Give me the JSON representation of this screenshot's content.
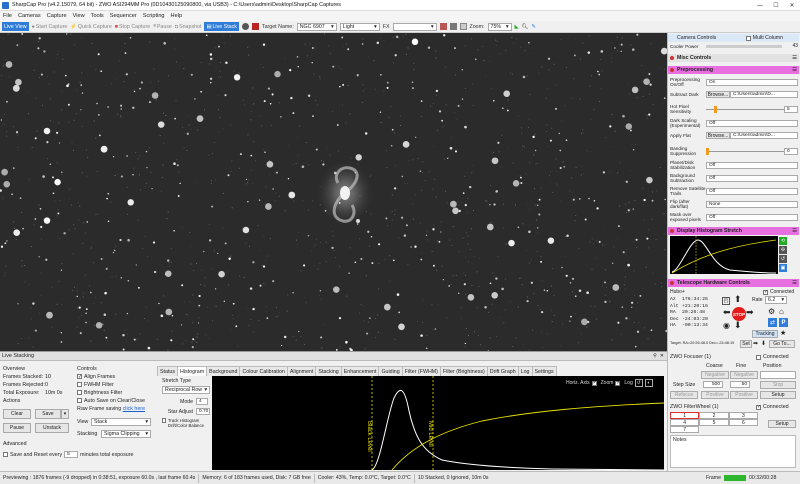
{
  "window": {
    "title": "SharpCap Pro (v4.2.15079, 64 bit) - ZWO ASI294MM Pro (0D10430125090800, via USB3) - C:\\Users\\admin\\Desktop\\SharpCap Captures"
  },
  "menu": [
    "File",
    "Cameras",
    "Capture",
    "View",
    "Tools",
    "Sequencer",
    "Scripting",
    "Help"
  ],
  "toolbar": {
    "live_view": "Live View",
    "start_capture": "Start Capture",
    "quick_capture": "Quick Capture",
    "stop_capture": "Stop Capture",
    "pause": "Pause",
    "snapshot": "Snapshot",
    "live_stack": "Live Stack",
    "target_label": "Target Name:",
    "target_value": "NGC 6907",
    "frame_type": "Light",
    "fx_label": "FX",
    "zoom_label": "Zoom:",
    "zoom_value": "75%"
  },
  "right_panel": {
    "camera_controls": "Camera Controls",
    "multi_column": "Multi Column",
    "cooler_power_label": "Cooler Power",
    "cooler_power_value": "43",
    "misc_controls": "Misc Controls",
    "preprocessing": "Preprocessing",
    "rows": [
      {
        "label": "Preprocessing On/Off",
        "value": "On"
      },
      {
        "label": "Subtract Dark",
        "button": "Browse...",
        "value": "C:\\Users\\admin\\D..."
      },
      {
        "label": "Hot Pixel Sensitivity",
        "value": "5"
      },
      {
        "label": "Dark Scaling (Experimental)",
        "value": "Off"
      },
      {
        "label": "Apply Flat",
        "button": "Browse...",
        "value": "C:\\Users\\admin\\D..."
      },
      {
        "label": "Banding Suppression",
        "value": "0"
      },
      {
        "label": "Planet/Disk Stabilization",
        "value": "Off"
      },
      {
        "label": "Background Subtraction",
        "value": "Off"
      },
      {
        "label": "Remove Satellite Trails",
        "value": "Off"
      },
      {
        "label": "Flip (after dark/flat)",
        "value": "None"
      },
      {
        "label": "Mask over exposed pixels",
        "value": "Off"
      }
    ],
    "display_histogram": "Display Histogram Stretch",
    "telescope": "Telescope Hardware Controls",
    "mount_name": "Hubo+",
    "connected_label": "Connected",
    "az_label": "Az",
    "az": "176:34:26",
    "alt_label": "Alt",
    "alt": "+21:20:16",
    "ra_label": "RA",
    "ra": "20:26:48",
    "dec_label": "Dec",
    "dec": "-24:03:20",
    "ha_label": "HA",
    "ha": "-00:13:34",
    "rate_label": "Rate",
    "rate": "6.2",
    "stop": "STOP",
    "tracking": "Tracking",
    "target_line": "Target:  RA=20:26:48.0 Dec=-24:48:19",
    "set": "Set",
    "goto": "Go To..."
  },
  "live_stacking": {
    "title": "Live Stacking",
    "overview": "Overview",
    "frames_stacked_label": "Frames Stacked:",
    "frames_stacked": "10",
    "frames_rejected_label": "Frames Rejected:",
    "frames_rejected": "0",
    "total_exposure_label": "Total Exposure:",
    "total_exposure": "10m 0s",
    "actions": "Actions",
    "clear": "Clear",
    "save": "Save",
    "pause": "Pause",
    "unstack": "Unstack",
    "advanced": "Advanced",
    "save_reset": "Save and Reset every",
    "save_reset_value": "5",
    "save_reset_suffix": "minutes total exposure",
    "controls": "Controls",
    "align": "Align Frames",
    "fwhm": "FWHM Filter",
    "brightness": "Brightness Filter",
    "autosave": "Auto Save on Clear/Close",
    "raw_frame": "Raw Frame saving",
    "click_here": "click here",
    "view_label": "View",
    "view_value": "Stack",
    "stacking_label": "Stacking",
    "stacking_value": "Sigma Clipping",
    "tabs": [
      "Status",
      "Histogram",
      "Background",
      "Colour Calibration",
      "Alignment",
      "Stacking",
      "Enhancement",
      "Guiding",
      "Filter (FWHM)",
      "Filter (Brightness)",
      "Drift Graph",
      "Log",
      "Settings"
    ],
    "stretch_type": "Stretch Type",
    "stretch_value": "Reciprocal Row",
    "mode_label": "Mode",
    "mode_value": "4",
    "star_adjust_label": "Star Adjust",
    "star_adjust_value": "0.70",
    "track_histogram": "Track Histogram Drift/Color Balance",
    "horiz_axis": "Horiz. Axis",
    "zoom": "Zoom",
    "log": "Log",
    "black_level": "Black Level",
    "mid_level": "Mid Level"
  },
  "focuser": {
    "title": "ZWO Focuser (1)",
    "connected": "Connected",
    "coarse": "Coarse",
    "fine": "Fine",
    "position": "Position",
    "negative": "Negative",
    "positive": "Positive",
    "step_size": "Step Size",
    "coarse_step": "500",
    "fine_step": "50",
    "stop": "Stop",
    "refocus": "Refocus",
    "setup": "Setup"
  },
  "filterwheel": {
    "title": "ZWO FilterWheel (1)",
    "connected": "Connected",
    "slots": [
      "1",
      "2",
      "3",
      "4",
      "5",
      "6",
      "7"
    ],
    "setup": "Setup",
    "notes": "Notes"
  },
  "status": {
    "preview": "Previewing : 1876 frames (-9 dropped) in 0:38:51, exposure 60.0s , last frame 60.4s",
    "memory": "Memory: 6 of 183 frames used, Disk: 7 GB free",
    "cooler": "Cooler: 43%, Temp: 0.0°C, Target: 0.0°C",
    "stacked": "10 Stacked, 0 Ignored, 10m 0s",
    "frame_label": "Frame",
    "time": "00:32/00:28"
  },
  "colors": {
    "accent": "#2f7dd8",
    "preprocessing": "#e86fe0",
    "telescope": "#e86fe0",
    "stop": "#e31b1b"
  }
}
